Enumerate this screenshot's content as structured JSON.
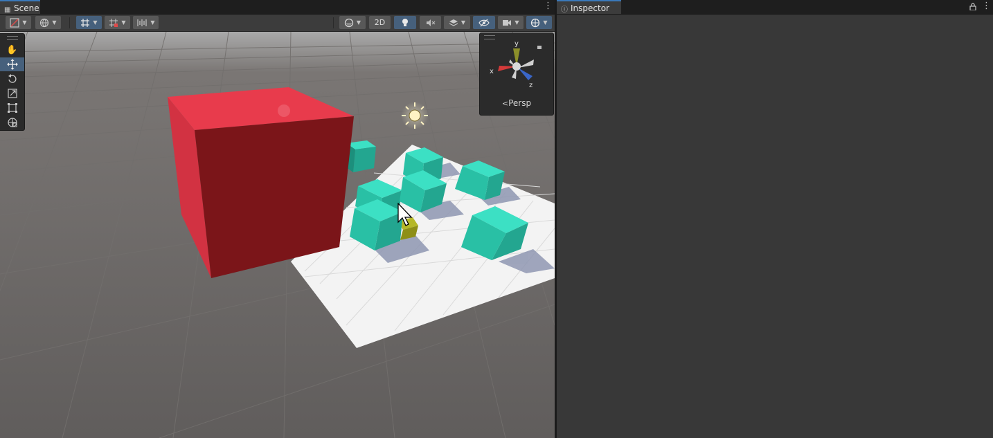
{
  "scene_tab": {
    "label": "Scene",
    "icon": "grid-icon"
  },
  "inspector_tab": {
    "label": "Inspector",
    "icon": "info-icon"
  },
  "toolbar": {
    "two_d_label": "2D"
  },
  "gizmo": {
    "projection_label": "Persp",
    "axis_x": "x",
    "axis_y": "y",
    "axis_z": "z"
  },
  "tools": [
    "hand-tool",
    "move-tool",
    "rotate-tool",
    "scale-tool",
    "rect-tool",
    "transform-tool"
  ],
  "active_tool": "move-tool",
  "colors": {
    "red_cube": "#e0313f",
    "teal_cube": "#27c7a8",
    "accent": "#46607c",
    "ground": "#62605f",
    "plane": "#f2f2f2"
  }
}
